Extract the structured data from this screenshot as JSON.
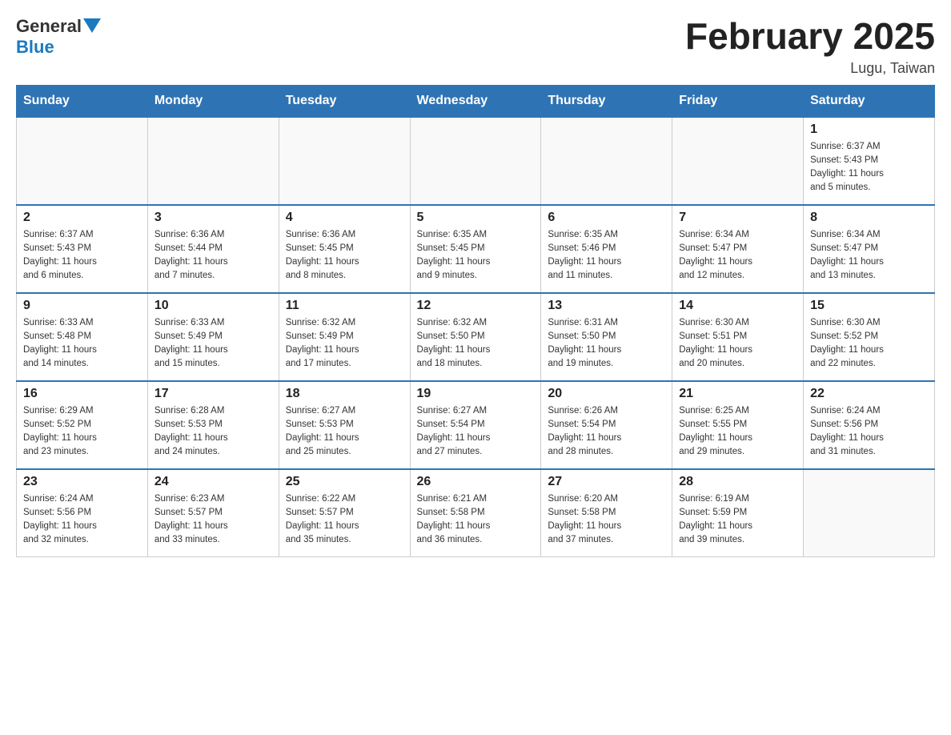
{
  "logo": {
    "general": "General",
    "blue": "Blue",
    "triangle_color": "#1a7abf"
  },
  "title": "February 2025",
  "location": "Lugu, Taiwan",
  "weekdays": [
    "Sunday",
    "Monday",
    "Tuesday",
    "Wednesday",
    "Thursday",
    "Friday",
    "Saturday"
  ],
  "weeks": [
    {
      "days": [
        {
          "num": "",
          "info": ""
        },
        {
          "num": "",
          "info": ""
        },
        {
          "num": "",
          "info": ""
        },
        {
          "num": "",
          "info": ""
        },
        {
          "num": "",
          "info": ""
        },
        {
          "num": "",
          "info": ""
        },
        {
          "num": "1",
          "info": "Sunrise: 6:37 AM\nSunset: 5:43 PM\nDaylight: 11 hours\nand 5 minutes."
        }
      ]
    },
    {
      "days": [
        {
          "num": "2",
          "info": "Sunrise: 6:37 AM\nSunset: 5:43 PM\nDaylight: 11 hours\nand 6 minutes."
        },
        {
          "num": "3",
          "info": "Sunrise: 6:36 AM\nSunset: 5:44 PM\nDaylight: 11 hours\nand 7 minutes."
        },
        {
          "num": "4",
          "info": "Sunrise: 6:36 AM\nSunset: 5:45 PM\nDaylight: 11 hours\nand 8 minutes."
        },
        {
          "num": "5",
          "info": "Sunrise: 6:35 AM\nSunset: 5:45 PM\nDaylight: 11 hours\nand 9 minutes."
        },
        {
          "num": "6",
          "info": "Sunrise: 6:35 AM\nSunset: 5:46 PM\nDaylight: 11 hours\nand 11 minutes."
        },
        {
          "num": "7",
          "info": "Sunrise: 6:34 AM\nSunset: 5:47 PM\nDaylight: 11 hours\nand 12 minutes."
        },
        {
          "num": "8",
          "info": "Sunrise: 6:34 AM\nSunset: 5:47 PM\nDaylight: 11 hours\nand 13 minutes."
        }
      ]
    },
    {
      "days": [
        {
          "num": "9",
          "info": "Sunrise: 6:33 AM\nSunset: 5:48 PM\nDaylight: 11 hours\nand 14 minutes."
        },
        {
          "num": "10",
          "info": "Sunrise: 6:33 AM\nSunset: 5:49 PM\nDaylight: 11 hours\nand 15 minutes."
        },
        {
          "num": "11",
          "info": "Sunrise: 6:32 AM\nSunset: 5:49 PM\nDaylight: 11 hours\nand 17 minutes."
        },
        {
          "num": "12",
          "info": "Sunrise: 6:32 AM\nSunset: 5:50 PM\nDaylight: 11 hours\nand 18 minutes."
        },
        {
          "num": "13",
          "info": "Sunrise: 6:31 AM\nSunset: 5:50 PM\nDaylight: 11 hours\nand 19 minutes."
        },
        {
          "num": "14",
          "info": "Sunrise: 6:30 AM\nSunset: 5:51 PM\nDaylight: 11 hours\nand 20 minutes."
        },
        {
          "num": "15",
          "info": "Sunrise: 6:30 AM\nSunset: 5:52 PM\nDaylight: 11 hours\nand 22 minutes."
        }
      ]
    },
    {
      "days": [
        {
          "num": "16",
          "info": "Sunrise: 6:29 AM\nSunset: 5:52 PM\nDaylight: 11 hours\nand 23 minutes."
        },
        {
          "num": "17",
          "info": "Sunrise: 6:28 AM\nSunset: 5:53 PM\nDaylight: 11 hours\nand 24 minutes."
        },
        {
          "num": "18",
          "info": "Sunrise: 6:27 AM\nSunset: 5:53 PM\nDaylight: 11 hours\nand 25 minutes."
        },
        {
          "num": "19",
          "info": "Sunrise: 6:27 AM\nSunset: 5:54 PM\nDaylight: 11 hours\nand 27 minutes."
        },
        {
          "num": "20",
          "info": "Sunrise: 6:26 AM\nSunset: 5:54 PM\nDaylight: 11 hours\nand 28 minutes."
        },
        {
          "num": "21",
          "info": "Sunrise: 6:25 AM\nSunset: 5:55 PM\nDaylight: 11 hours\nand 29 minutes."
        },
        {
          "num": "22",
          "info": "Sunrise: 6:24 AM\nSunset: 5:56 PM\nDaylight: 11 hours\nand 31 minutes."
        }
      ]
    },
    {
      "days": [
        {
          "num": "23",
          "info": "Sunrise: 6:24 AM\nSunset: 5:56 PM\nDaylight: 11 hours\nand 32 minutes."
        },
        {
          "num": "24",
          "info": "Sunrise: 6:23 AM\nSunset: 5:57 PM\nDaylight: 11 hours\nand 33 minutes."
        },
        {
          "num": "25",
          "info": "Sunrise: 6:22 AM\nSunset: 5:57 PM\nDaylight: 11 hours\nand 35 minutes."
        },
        {
          "num": "26",
          "info": "Sunrise: 6:21 AM\nSunset: 5:58 PM\nDaylight: 11 hours\nand 36 minutes."
        },
        {
          "num": "27",
          "info": "Sunrise: 6:20 AM\nSunset: 5:58 PM\nDaylight: 11 hours\nand 37 minutes."
        },
        {
          "num": "28",
          "info": "Sunrise: 6:19 AM\nSunset: 5:59 PM\nDaylight: 11 hours\nand 39 minutes."
        },
        {
          "num": "",
          "info": ""
        }
      ]
    }
  ]
}
